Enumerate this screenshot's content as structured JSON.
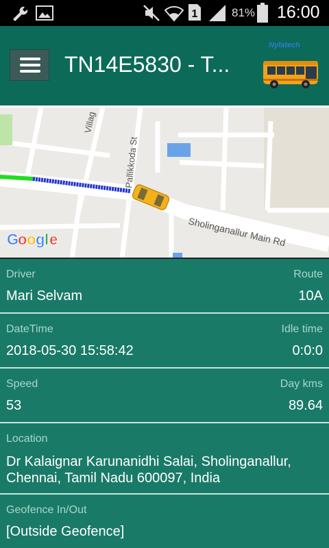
{
  "status": {
    "battery_pct": "81%",
    "time": "16:00",
    "sim_slot": "1"
  },
  "header": {
    "title": "TN14E5830 - T...",
    "brand": "Nylatech"
  },
  "map": {
    "street1": "Sholinganallur Main Rd",
    "street2": "Pallikkoda St",
    "street3": "Villag",
    "google": [
      "G",
      "o",
      "o",
      "g",
      "l",
      "e"
    ],
    "google_colors": [
      "#4285F4",
      "#EA4335",
      "#FBBC05",
      "#4285F4",
      "#34A853",
      "#EA4335"
    ]
  },
  "info": {
    "driver_label": "Driver",
    "driver_value": "Mari Selvam",
    "route_label": "Route",
    "route_value": "10A",
    "datetime_label": "DateTime",
    "datetime_value": "2018-05-30 15:58:42",
    "idle_label": "Idle time",
    "idle_value": "0:0:0",
    "speed_label": "Speed",
    "speed_value": "53",
    "daykms_label": "Day kms",
    "daykms_value": "89.64",
    "location_label": "Location",
    "location_value_line1": "Dr Kalaignar Karunanidhi Salai, Sholinganallur,",
    "location_value_line2": "Chennai, Tamil Nadu 600097, India",
    "geofence_label": "Geofence In/Out",
    "geofence_value": "[Outside Geofence]"
  }
}
